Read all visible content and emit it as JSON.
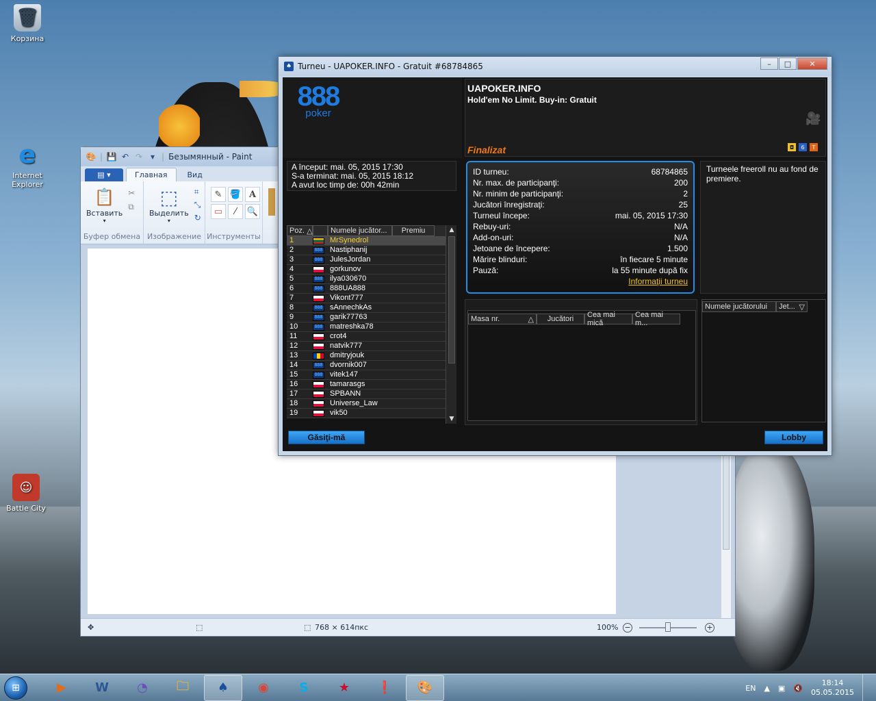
{
  "desktop": {
    "icons": [
      {
        "label": "Корзина"
      },
      {
        "label": "Internet Explorer"
      },
      {
        "label": "Battle City"
      }
    ]
  },
  "paint": {
    "title": "Безымянный - Paint",
    "tabs": {
      "file": "▤ ▾",
      "home": "Главная",
      "view": "Вид"
    },
    "ribbon": {
      "paste_label": "Вставить",
      "select_label": "Выделить",
      "groups": {
        "clipboard": "Буфер обмена",
        "image": "Изображение",
        "tools": "Инструменты"
      }
    },
    "status": {
      "size": "768 × 614пкс",
      "zoom": "100%",
      "zoom_level": 1.0
    }
  },
  "poker": {
    "title": "Turneu - UAPOKER.INFO - Gratuit #68784865",
    "logo": {
      "number": "888",
      "word": "poker"
    },
    "tournament_name": "UAPOKER.INFO",
    "description": "Hold'em No Limit. Buy-in: Gratuit",
    "status": "Finalizat",
    "times": {
      "started": "A început: mai. 05, 2015 17:30",
      "ended": "S-a terminat: mai. 05, 2015 18:12",
      "duration": "A avut loc timp de: 00h 42min"
    },
    "player_list": {
      "headers": {
        "pos": "Poz.",
        "name": "Numele jucător...",
        "prize": "Premiu"
      },
      "rows": [
        {
          "pos": "1",
          "flag": "lt",
          "name": "MrSynedrol"
        },
        {
          "pos": "2",
          "flag": "b8",
          "name": "Nastiphanij"
        },
        {
          "pos": "3",
          "flag": "b8",
          "name": "JulesJordan"
        },
        {
          "pos": "4",
          "flag": "pl",
          "name": "gorkunov"
        },
        {
          "pos": "5",
          "flag": "b8",
          "name": "ilya030670"
        },
        {
          "pos": "6",
          "flag": "b8",
          "name": "888UA888"
        },
        {
          "pos": "7",
          "flag": "pl",
          "name": "Vikont777"
        },
        {
          "pos": "8",
          "flag": "b8",
          "name": "sAnnechkAs"
        },
        {
          "pos": "9",
          "flag": "b8",
          "name": "garik77763"
        },
        {
          "pos": "10",
          "flag": "b8",
          "name": "matreshka78"
        },
        {
          "pos": "11",
          "flag": "pl",
          "name": "crot4"
        },
        {
          "pos": "12",
          "flag": "pl",
          "name": "natvik777"
        },
        {
          "pos": "13",
          "flag": "md",
          "name": "dmitryjouk"
        },
        {
          "pos": "14",
          "flag": "b8",
          "name": "dvornik007"
        },
        {
          "pos": "15",
          "flag": "b8",
          "name": "vitek147"
        },
        {
          "pos": "16",
          "flag": "pl",
          "name": "tamarasgs"
        },
        {
          "pos": "17",
          "flag": "pl",
          "name": "SPBANN"
        },
        {
          "pos": "18",
          "flag": "pl",
          "name": "Universe_Law"
        },
        {
          "pos": "19",
          "flag": "pl",
          "name": "vik50"
        }
      ]
    },
    "info": {
      "rows": [
        {
          "label": "ID turneu:",
          "value": "68784865"
        },
        {
          "label": "Nr. max. de participanţi:",
          "value": "200"
        },
        {
          "label": "Nr. minim de participanţi:",
          "value": "2"
        },
        {
          "label": "Jucători înregistraţi:",
          "value": "25"
        },
        {
          "label": "Turneul începe:",
          "value": "mai. 05, 2015 17:30"
        },
        {
          "label": "Rebuy-uri:",
          "value": "N/A"
        },
        {
          "label": "Add-on-uri:",
          "value": "N/A"
        },
        {
          "label": "Jetoane de începere:",
          "value": "1.500"
        },
        {
          "label": "Mărire blinduri:",
          "value": "în fiecare 5 minute"
        },
        {
          "label": "Pauză:",
          "value": "la 55 minute după fix"
        }
      ],
      "link": "Informaţii turneu"
    },
    "freeroll_note": "Turneele freeroll nu au fond de premiere.",
    "tables_headers": {
      "table": "Masa nr.",
      "players": "Jucători",
      "min": "Cea mai mică",
      "max": "Cea mai m..."
    },
    "player_panel_headers": {
      "name": "Numele jucătorului",
      "chips": "Jet..."
    },
    "buttons": {
      "find_me": "Găsiţi-mă",
      "lobby": "Lobby"
    }
  },
  "taskbar": {
    "language": "EN",
    "time": "18:14",
    "date": "05.05.2015"
  }
}
